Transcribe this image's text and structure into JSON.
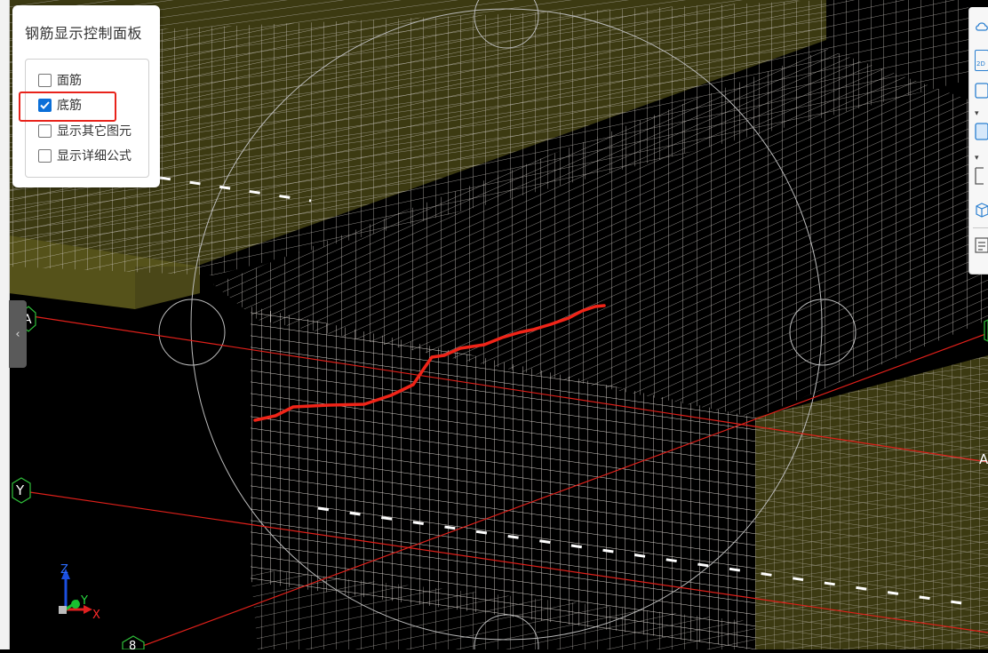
{
  "panel": {
    "title": "钢筋显示控制面板",
    "options": [
      {
        "label": "面筋",
        "checked": false
      },
      {
        "label": "底筋",
        "checked": true
      },
      {
        "label": "显示其它图元",
        "checked": false
      },
      {
        "label": "显示详细公式",
        "checked": false
      }
    ]
  },
  "viewport": {
    "axis_labels": {
      "a_left": "A",
      "a_right": "A",
      "y": "Y",
      "b_bottom": "8"
    },
    "triad": {
      "x": "X",
      "y": "Y",
      "z": "Z"
    }
  },
  "toolbar": {
    "icons": [
      "cloud-icon",
      "2d-view-icon",
      "cube-view-icon",
      "chevron-down-icon",
      "cube-solid-icon",
      "chevron-down-icon",
      "box-select-icon",
      "cube-rotate-icon",
      "list-icon"
    ],
    "label_2d": "2D"
  },
  "colors": {
    "background": "#000000",
    "slab": "#3c3a12",
    "rebar": "#d8d2cc",
    "grid_line": "#e0201a",
    "highlight": "#e8231b",
    "checkbox": "#0b6fd8"
  }
}
